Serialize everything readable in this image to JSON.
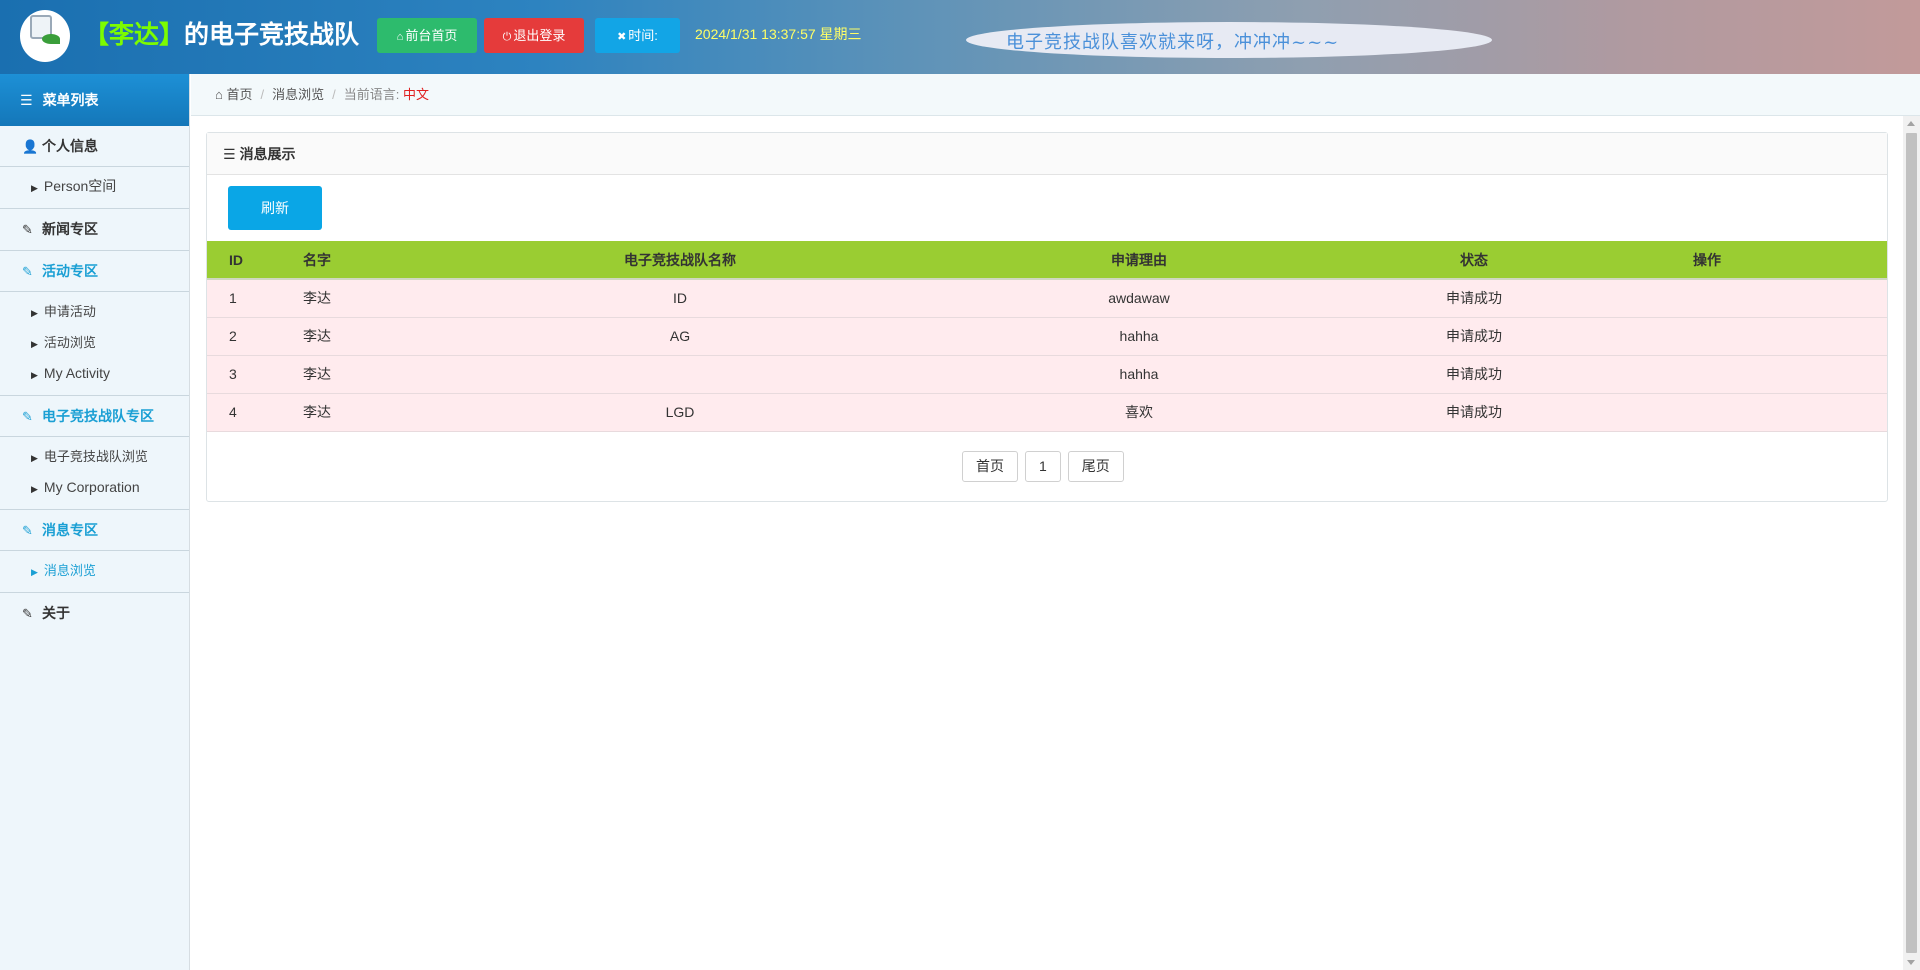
{
  "header": {
    "title_bracket_open": "【",
    "user_name": "李达",
    "title_bracket_close": "】",
    "title_suffix": "的电子竞技战队",
    "home_btn": "前台首页",
    "logout_btn": "退出登录",
    "time_btn": "时间:",
    "datetime": "2024/1/31 13:37:57 星期三",
    "marquee": "电子竞技战队喜欢就来呀，冲冲冲~~~",
    "title_color": "#ffffff",
    "user_name_color": "#7CFC00"
  },
  "sidebar": {
    "menu_title": "菜单列表",
    "sections": [
      {
        "title": "个人信息",
        "icon": "user-icon",
        "items": [
          "Person空间"
        ]
      },
      {
        "title": "新闻专区",
        "icon": "edit-icon",
        "items": []
      },
      {
        "title": "活动专区",
        "icon": "edit-icon",
        "items": [
          "申请活动",
          "活动浏览",
          "My Activity"
        ]
      },
      {
        "title": "电子竞技战队专区",
        "icon": "edit-icon",
        "items": [
          "电子竞技战队浏览",
          "My Corporation"
        ]
      },
      {
        "title": "消息专区",
        "icon": "edit-icon",
        "items": [
          "消息浏览"
        ]
      },
      {
        "title": "关于",
        "icon": "edit-icon",
        "items": []
      }
    ],
    "active_color": "#1a9fd4"
  },
  "breadcrumb": {
    "home": "首页",
    "current": "消息浏览",
    "lang_label": "当前语言:",
    "lang_value": "中文"
  },
  "panel": {
    "title": "消息展示",
    "refresh_btn": "刷新"
  },
  "table": {
    "headers": [
      "ID",
      "名字",
      "电子竞技战队名称",
      "申请理由",
      "状态",
      "操作"
    ],
    "rows": [
      {
        "id": "1",
        "name": "李达",
        "team": "ID",
        "reason": "awdawaw",
        "status": "申请成功",
        "op": ""
      },
      {
        "id": "2",
        "name": "李达",
        "team": "AG",
        "reason": "hahha",
        "status": "申请成功",
        "op": ""
      },
      {
        "id": "3",
        "name": "李达",
        "team": "",
        "reason": "hahha",
        "status": "申请成功",
        "op": ""
      },
      {
        "id": "4",
        "name": "李达",
        "team": "LGD",
        "reason": "喜欢",
        "status": "申请成功",
        "op": ""
      }
    ],
    "header_bg": "#9acd32",
    "row_bg": "#ffebee"
  },
  "pager": {
    "first": "首页",
    "page": "1",
    "last": "尾页"
  }
}
